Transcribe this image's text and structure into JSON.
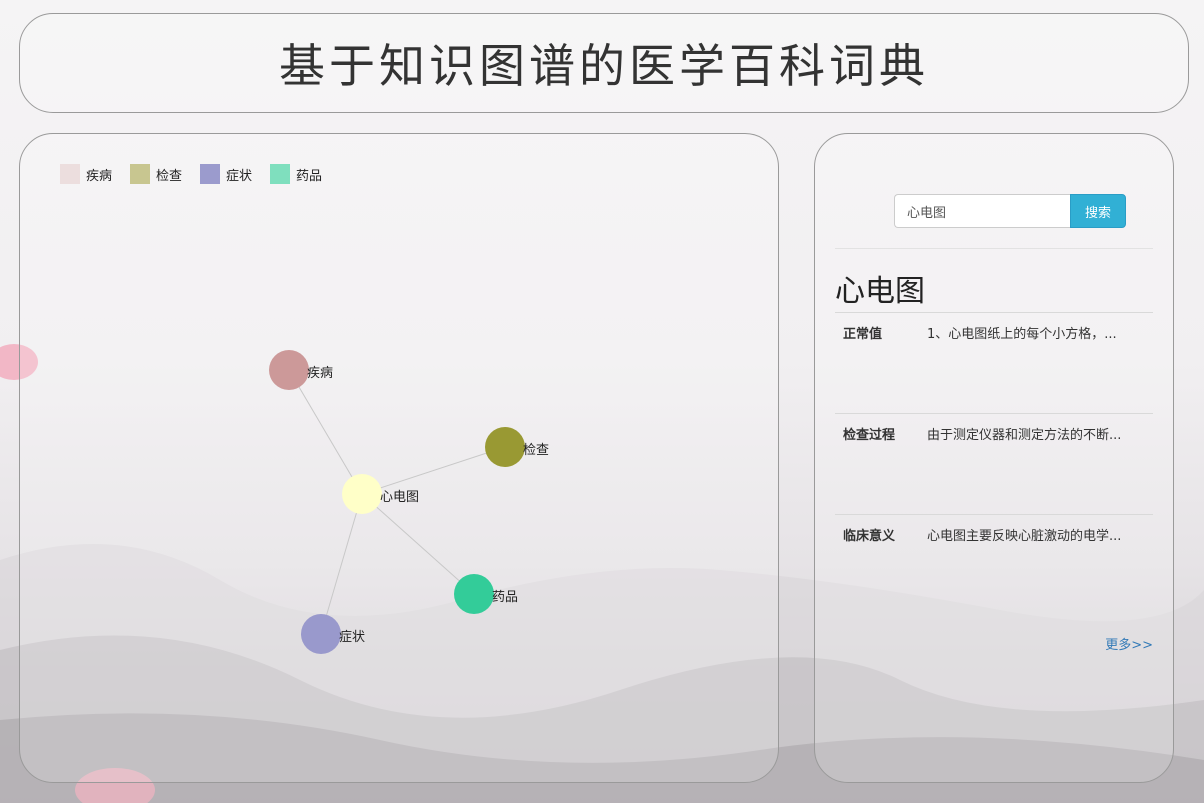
{
  "header": {
    "title": "基于知识图谱的医学百科词典"
  },
  "legend": [
    {
      "label": "疾病",
      "color": "#ecdede"
    },
    {
      "label": "检查",
      "color": "#c8c690"
    },
    {
      "label": "症状",
      "color": "#9b9bcd"
    },
    {
      "label": "药品",
      "color": "#7fdfbe"
    }
  ],
  "graph": {
    "nodes": [
      {
        "id": "center",
        "label": "心电图",
        "color": "#ffffc8"
      },
      {
        "id": "disease",
        "label": "疾病",
        "color": "#cc9999"
      },
      {
        "id": "exam",
        "label": "检查",
        "color": "#999933"
      },
      {
        "id": "drug",
        "label": "药品",
        "color": "#33cc99"
      },
      {
        "id": "symptom",
        "label": "症状",
        "color": "#9999cc"
      }
    ],
    "edges": [
      {
        "source": "center",
        "target": "disease"
      },
      {
        "source": "center",
        "target": "exam"
      },
      {
        "source": "center",
        "target": "drug"
      },
      {
        "source": "center",
        "target": "symptom"
      }
    ]
  },
  "search": {
    "value": "心电图",
    "button_label": "搜索"
  },
  "entity": {
    "title": "心电图",
    "rows": [
      {
        "key": "正常值",
        "value": "1、心电图纸上的每个小方格，..."
      },
      {
        "key": "检查过程",
        "value": "由于测定仪器和测定方法的不断..."
      },
      {
        "key": "临床意义",
        "value": "心电图主要反映心脏激动的电学..."
      }
    ],
    "more_label": "更多>>"
  }
}
